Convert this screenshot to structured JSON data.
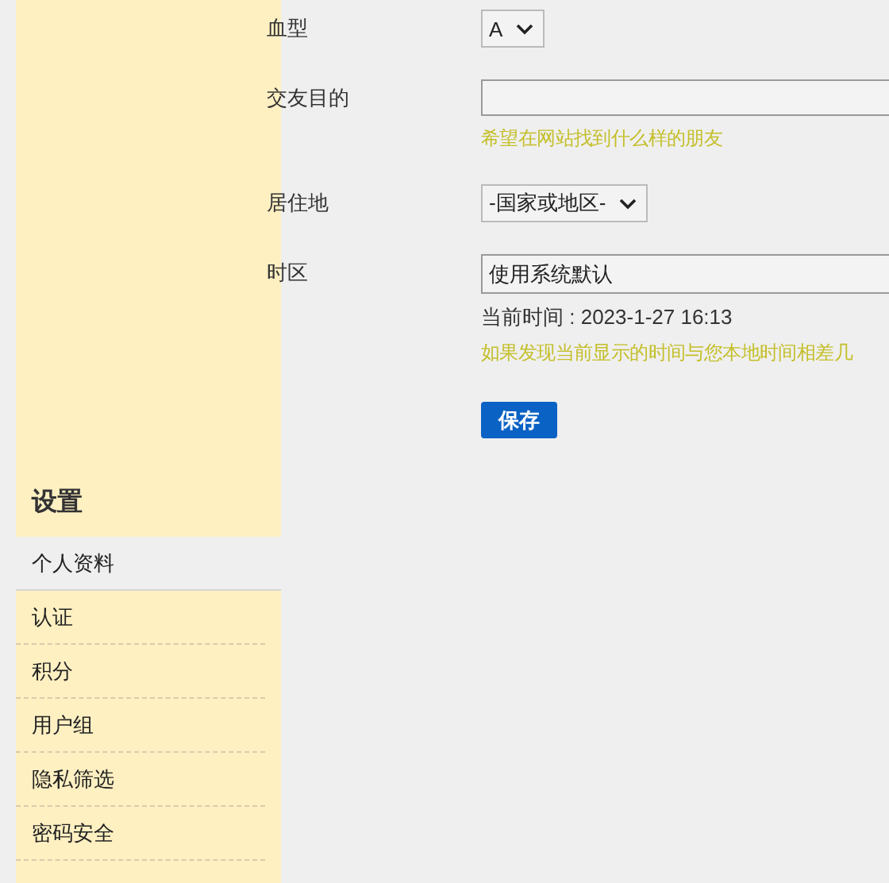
{
  "form": {
    "rows": [
      {
        "label": "血型",
        "kind": "select",
        "value": "A"
      },
      {
        "label": "交友目的",
        "kind": "input",
        "hint": "希望在网站找到什么样的朋友"
      },
      {
        "label": "居住地",
        "kind": "select",
        "value": "-国家或地区-"
      },
      {
        "label": "时区",
        "kind": "wide_select",
        "value": "使用系统默认",
        "note": "当前时间 : 2023-1-27 16:13",
        "hint": "如果发现当前显示的时间与您本地时间相差几"
      }
    ],
    "save_button": "保存"
  },
  "sidebar": {
    "title": "设置",
    "items": [
      {
        "label": "个人资料",
        "selected": true
      },
      {
        "label": "认证",
        "selected": false
      },
      {
        "label": "积分",
        "selected": false
      },
      {
        "label": "用户组",
        "selected": false
      },
      {
        "label": "隐私筛选",
        "selected": false
      },
      {
        "label": "密码安全",
        "selected": false
      }
    ]
  }
}
